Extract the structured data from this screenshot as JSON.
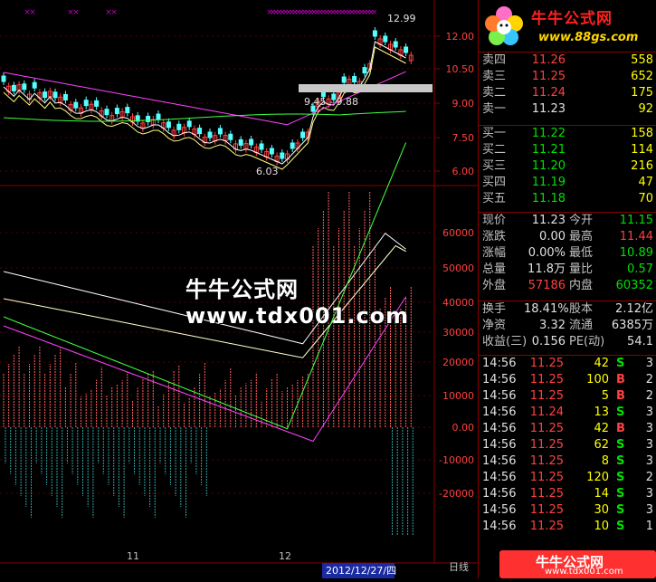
{
  "logo": {
    "title": "牛牛公式网",
    "url": "www.88gs.com"
  },
  "watermark": "牛牛公式网 www.tdx001.com",
  "badge": {
    "title": "牛牛公式网",
    "url": "www.tdx001.com"
  },
  "price_chart": {
    "y_ticks": [
      "12.00",
      "10.50",
      "9.00",
      "7.50",
      "6.00"
    ],
    "annotations": {
      "high": "12.99",
      "low": "6.03",
      "gap": "9.45 - 9.88"
    }
  },
  "volume_chart": {
    "y_ticks": [
      "60000",
      "50000",
      "40000",
      "30000",
      "20000",
      "10000",
      "0.00",
      "-10000",
      "-20000"
    ]
  },
  "x_axis": {
    "months": [
      "11",
      "12"
    ],
    "cursor_date": "2012/12/27/四",
    "period": "日线"
  },
  "order_book": {
    "asks": [
      {
        "label": "卖四",
        "price": "11.26",
        "vol": "558"
      },
      {
        "label": "卖三",
        "price": "11.25",
        "vol": "652"
      },
      {
        "label": "卖二",
        "price": "11.24",
        "vol": "175"
      },
      {
        "label": "卖一",
        "price": "11.23",
        "vol": "92"
      }
    ],
    "bids": [
      {
        "label": "买一",
        "price": "11.22",
        "vol": "158"
      },
      {
        "label": "买二",
        "price": "11.21",
        "vol": "114"
      },
      {
        "label": "买三",
        "price": "11.20",
        "vol": "216"
      },
      {
        "label": "买四",
        "price": "11.19",
        "vol": "47"
      },
      {
        "label": "买五",
        "price": "11.18",
        "vol": "70"
      }
    ]
  },
  "quote": [
    {
      "l1": "现价",
      "v1": "11.23",
      "l2": "今开",
      "v2": "11.15"
    },
    {
      "l1": "涨跌",
      "v1": "0.00",
      "l2": "最高",
      "v2": "11.44"
    },
    {
      "l1": "涨幅",
      "v1": "0.00%",
      "l2": "最低",
      "v2": "10.89"
    },
    {
      "l1": "总量",
      "v1": "11.8万",
      "l2": "量比",
      "v2": "0.57"
    },
    {
      "l1": "外盘",
      "v1": "57186",
      "l2": "内盘",
      "v2": "60352"
    }
  ],
  "fundamentals": [
    {
      "l1": "换手",
      "v1": "18.41%",
      "l2": "股本",
      "v2": "2.12亿"
    },
    {
      "l1": "净资",
      "v1": "3.32",
      "l2": "流通",
      "v2": "6385万"
    },
    {
      "l1": "收益(三)",
      "v1": "0.156",
      "l2": "PE(动)",
      "v2": "54.1"
    }
  ],
  "trades": [
    {
      "time": "14:56",
      "price": "11.25",
      "vol": "42",
      "side": "S",
      "n": "3"
    },
    {
      "time": "14:56",
      "price": "11.25",
      "vol": "100",
      "side": "B",
      "n": "2"
    },
    {
      "time": "14:56",
      "price": "11.25",
      "vol": "5",
      "side": "B",
      "n": "2"
    },
    {
      "time": "14:56",
      "price": "11.24",
      "vol": "13",
      "side": "S",
      "n": "3"
    },
    {
      "time": "14:56",
      "price": "11.25",
      "vol": "42",
      "side": "B",
      "n": "3"
    },
    {
      "time": "14:56",
      "price": "11.25",
      "vol": "62",
      "side": "S",
      "n": "3"
    },
    {
      "time": "14:56",
      "price": "11.25",
      "vol": "8",
      "side": "S",
      "n": "3"
    },
    {
      "time": "14:56",
      "price": "11.25",
      "vol": "120",
      "side": "S",
      "n": "2"
    },
    {
      "time": "14:56",
      "price": "11.25",
      "vol": "14",
      "side": "S",
      "n": "3"
    },
    {
      "time": "14:56",
      "price": "11.25",
      "vol": "30",
      "side": "S",
      "n": "3"
    },
    {
      "time": "14:56",
      "price": "11.25",
      "vol": "10",
      "side": "S",
      "n": "1"
    }
  ],
  "colors": {
    "up": "#ff4040",
    "down": "#00e000",
    "bg": "#000000",
    "grid": "#8b0000"
  }
}
